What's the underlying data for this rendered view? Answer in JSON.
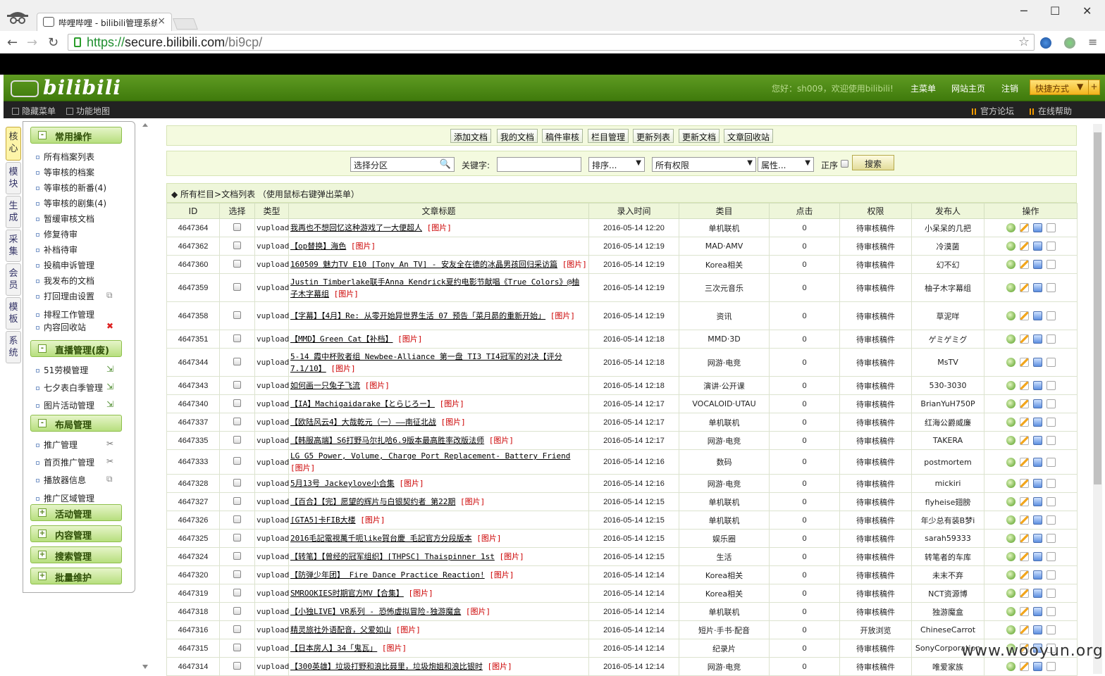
{
  "browser": {
    "tab_title": "哔哩哔哩 - bilibili管理系统",
    "url_scheme": "https://",
    "url_host": "secure.bilibili.com",
    "url_path": "/bi9cp/",
    "close_glyph": "×",
    "win_min": "─",
    "win_max": "☐",
    "win_close": "✕"
  },
  "header": {
    "logo_text": "bilibili",
    "welcome": "您好：sh009，欢迎使用bilibili!",
    "links": [
      "主菜单",
      "网站主页",
      "注销"
    ],
    "quick": "快捷方式",
    "quick_arrow": "▼",
    "quick_plus": "+"
  },
  "subbar": {
    "left": [
      "隐藏菜单",
      "功能地图"
    ],
    "right": [
      "官方论坛",
      "在线帮助"
    ]
  },
  "vtabs": [
    "核心",
    "模块",
    "生成",
    "采集",
    "会员",
    "模板",
    "系统"
  ],
  "menu": {
    "groups": [
      "常用操作",
      "直播管理(废)",
      "布局管理",
      "活动管理",
      "内容管理",
      "搜索管理",
      "批量维护"
    ],
    "common_items": [
      "所有档案列表",
      "等审核的档案",
      "等审核的新番(4)",
      "等审核的剧集(4)",
      "暂缓审核文档",
      "修复待审",
      "补档待审",
      "投稿申诉管理",
      "我发布的文档",
      "打回理由设置",
      "排程工作管理",
      "内容回收站"
    ],
    "live_items": [
      "51劳模管理",
      "七夕表白季管理",
      "图片活动管理"
    ],
    "layout_items": [
      "推广管理",
      "首页推广管理",
      "播放器信息",
      "推广区域管理"
    ]
  },
  "actions": [
    "添加文档",
    "我的文档",
    "稿件审核",
    "栏目管理",
    "更新列表",
    "更新文档",
    "文章回收站"
  ],
  "search": {
    "category_placeholder": "选择分区",
    "keyword_label": "关键字:",
    "sort": "排序...",
    "perm": "所有权限",
    "attr": "属性...",
    "order_label": "正序",
    "button": "搜索"
  },
  "breadcrumb": "◆ 所有栏目>文档列表  （使用鼠标右键弹出菜单）",
  "table": {
    "headers": [
      "ID",
      "选择",
      "类型",
      "文章标题",
      "录入时间",
      "类目",
      "点击",
      "权限",
      "发布人",
      "操作"
    ],
    "img_label": "[图片]",
    "rows": [
      {
        "id": "4647364",
        "type": "vupload",
        "title": "我再也不想回忆这种游戏了一大便超人",
        "time": "2016-05-14 12:20",
        "cat": "单机联机",
        "clicks": "0",
        "perm": "待审核稿件",
        "author": "小呆呆的几把"
      },
      {
        "id": "4647362",
        "type": "vupload",
        "title": "【op替换】海色",
        "time": "2016-05-14 12:19",
        "cat": "MAD·AMV",
        "clicks": "0",
        "perm": "待审核稿件",
        "author": "冷漠菌"
      },
      {
        "id": "4647360",
        "type": "vupload",
        "title": "160509 魅力TV E10 [Tony An TV] - 安友全在德的冰晶男孩回归采访篇",
        "time": "2016-05-14 12:19",
        "cat": "Korea相关",
        "clicks": "0",
        "perm": "待审核稿件",
        "author": "幻不幻"
      },
      {
        "id": "4647359",
        "type": "vupload",
        "title": "Justin Timberlake联手Anna Kendrick夏约电影节献唱《True Colors》@柚子木字幕组",
        "time": "2016-05-14 12:19",
        "cat": "三次元音乐",
        "clicks": "0",
        "perm": "待审核稿件",
        "author": "柚子木字幕组"
      },
      {
        "id": "4647358",
        "type": "vupload",
        "title": "【字幕】【4月】Re: 从零开始异世界生活 07 预告「菜月昴的重新开始」",
        "time": "2016-05-14 12:19",
        "cat": "资讯",
        "clicks": "0",
        "perm": "待审核稿件",
        "author": "草泥咩"
      },
      {
        "id": "4647351",
        "type": "vupload",
        "title": "【MMD】Green Cat【补档】",
        "time": "2016-05-14 12:18",
        "cat": "MMD·3D",
        "clicks": "0",
        "perm": "待审核稿件",
        "author": "ゲミゲミグ"
      },
      {
        "id": "4647344",
        "type": "vupload",
        "title": "5-14 霞中杯败者组 Newbee-Alliance 第一盘 TI3 TI4冠军的对决【评分7.1/10】",
        "time": "2016-05-14 12:18",
        "cat": "网游·电竞",
        "clicks": "0",
        "perm": "待审核稿件",
        "author": "MsTV"
      },
      {
        "id": "4647343",
        "type": "vupload",
        "title": "如何画一只兔子飞流",
        "time": "2016-05-14 12:18",
        "cat": "演讲·公开课",
        "clicks": "0",
        "perm": "待审核稿件",
        "author": "530-3030"
      },
      {
        "id": "4647340",
        "type": "vupload",
        "title": "【IA】Machigaidarake【とらじろー】",
        "time": "2016-05-14 12:17",
        "cat": "VOCALOID·UTAU",
        "clicks": "0",
        "perm": "待审核稿件",
        "author": "BrianYuH750P"
      },
      {
        "id": "4647337",
        "type": "vupload",
        "title": "【欧陆风云4】大哉乾元（一）——南征北战",
        "time": "2016-05-14 12:17",
        "cat": "单机联机",
        "clicks": "0",
        "perm": "待审核稿件",
        "author": "红海公爵威廉"
      },
      {
        "id": "4647335",
        "type": "vupload",
        "title": "【韩服高端】S6打野马尔扎哈6.9版本最高胜率改版法师",
        "time": "2016-05-14 12:17",
        "cat": "网游·电竞",
        "clicks": "0",
        "perm": "待审核稿件",
        "author": "TAKERA"
      },
      {
        "id": "4647333",
        "type": "vupload",
        "title": "LG G5 Power, Volume, Charge Port Replacement- Battery Friend",
        "time": "2016-05-14 12:16",
        "cat": "数码",
        "clicks": "0",
        "perm": "待审核稿件",
        "author": "postmortem"
      },
      {
        "id": "4647328",
        "type": "vupload",
        "title": "5月13号 Jackeylove小合集",
        "time": "2016-05-14 12:16",
        "cat": "网游·电竞",
        "clicks": "0",
        "perm": "待审核稿件",
        "author": "mickiri"
      },
      {
        "id": "4647327",
        "type": "vupload",
        "title": "【百合】【完】愿望的辉片与白银契约者 第22期",
        "time": "2016-05-14 12:15",
        "cat": "单机联机",
        "clicks": "0",
        "perm": "待审核稿件",
        "author": "flyheise翅膀"
      },
      {
        "id": "4647326",
        "type": "vupload",
        "title": "[GTA5]卡FIB大楼",
        "time": "2016-05-14 12:15",
        "cat": "单机联机",
        "clicks": "0",
        "perm": "待审核稿件",
        "author": "年少总有装B梦i"
      },
      {
        "id": "4647325",
        "type": "vupload",
        "title": "2016毛記電視萬千呃like賀台慶 毛記官方分段版本",
        "time": "2016-05-14 12:15",
        "cat": "娱乐圈",
        "clicks": "0",
        "perm": "待审核稿件",
        "author": "sarah59333"
      },
      {
        "id": "4647324",
        "type": "vupload",
        "title": "【转笔】【曾经的冠军组织】[THPSC] Thaispinner 1st",
        "time": "2016-05-14 12:15",
        "cat": "生活",
        "clicks": "0",
        "perm": "待审核稿件",
        "author": "转笔者的车库"
      },
      {
        "id": "4647320",
        "type": "vupload",
        "title": "【防弹少年团】 Fire Dance Practice Reaction!",
        "time": "2016-05-14 12:14",
        "cat": "Korea相关",
        "clicks": "0",
        "perm": "待审核稿件",
        "author": "未末不弃"
      },
      {
        "id": "4647319",
        "type": "vupload",
        "title": "SMROOKIES时期官方MV【合集】",
        "time": "2016-05-14 12:14",
        "cat": "Korea相关",
        "clicks": "0",
        "perm": "待审核稿件",
        "author": "NCT资源博"
      },
      {
        "id": "4647318",
        "type": "vupload",
        "title": "【小独LIVE】VR系列 - 恐怖虚拟冒险-独游魔盒",
        "time": "2016-05-14 12:14",
        "cat": "单机联机",
        "clicks": "0",
        "perm": "待审核稿件",
        "author": "独游魔盒"
      },
      {
        "id": "4647316",
        "type": "vupload",
        "title": "精灵旅社外语配音，父爱如山",
        "time": "2016-05-14 12:14",
        "cat": "短片·手书·配音",
        "clicks": "0",
        "perm": "开放浏览",
        "author": "ChineseCarrot"
      },
      {
        "id": "4647315",
        "type": "vupload",
        "title": "【日本房人】34「鬼瓦」",
        "time": "2016-05-14 12:14",
        "cat": "纪录片",
        "clicks": "0",
        "perm": "待审核稿件",
        "author": "SonyCorporation"
      },
      {
        "id": "4647314",
        "type": "vupload",
        "title": "【300英雄】垃圾打野和浪比聂里，垃圾炮姐和浪比银时",
        "time": "2016-05-14 12:14",
        "cat": "网游·电竞",
        "clicks": "0",
        "perm": "待审核稿件",
        "author": "唯爱家族"
      }
    ]
  },
  "watermark": "www.wooyun.org"
}
